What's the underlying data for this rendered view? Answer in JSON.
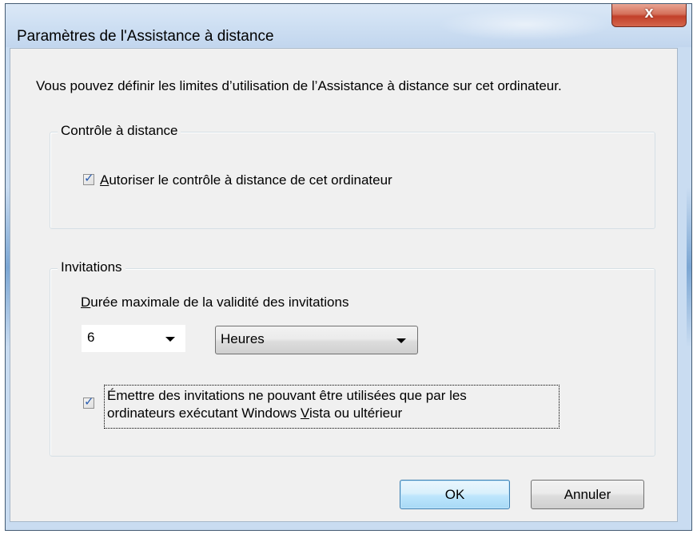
{
  "window": {
    "title": "Paramètres de l'Assistance à distance",
    "close_glyph": "x"
  },
  "intro_text": "Vous pouvez définir les limites d’utilisation de l’Assistance à distance sur cet ordinateur.",
  "remote_control_group": {
    "label": "Contrôle à distance",
    "checkbox": {
      "checked": true,
      "label_accesskey": "A",
      "label_rest": "utoriser le contrôle à distance de cet ordinateur"
    }
  },
  "invitations_group": {
    "label": "Invitations",
    "duration_label_accesskey": "D",
    "duration_label_rest": "urée maximale de la validité des invitations",
    "duration_value": "6",
    "duration_unit": "Heures",
    "vista_checkbox": {
      "checked": true,
      "line1": "Émettre des invitations ne pouvant être utilisées que par les",
      "line2_before": "ordinateurs exécutant Windows ",
      "line2_accesskey": "V",
      "line2_after": "ista ou ultérieur"
    }
  },
  "buttons": {
    "ok": "OK",
    "cancel": "Annuler"
  },
  "colors": {
    "frame": "#c9dcf1",
    "client_bg": "#f0f0f0",
    "close_button": "#c2402a",
    "checkmark": "#2a5db0",
    "default_button": "#bee6fd"
  }
}
